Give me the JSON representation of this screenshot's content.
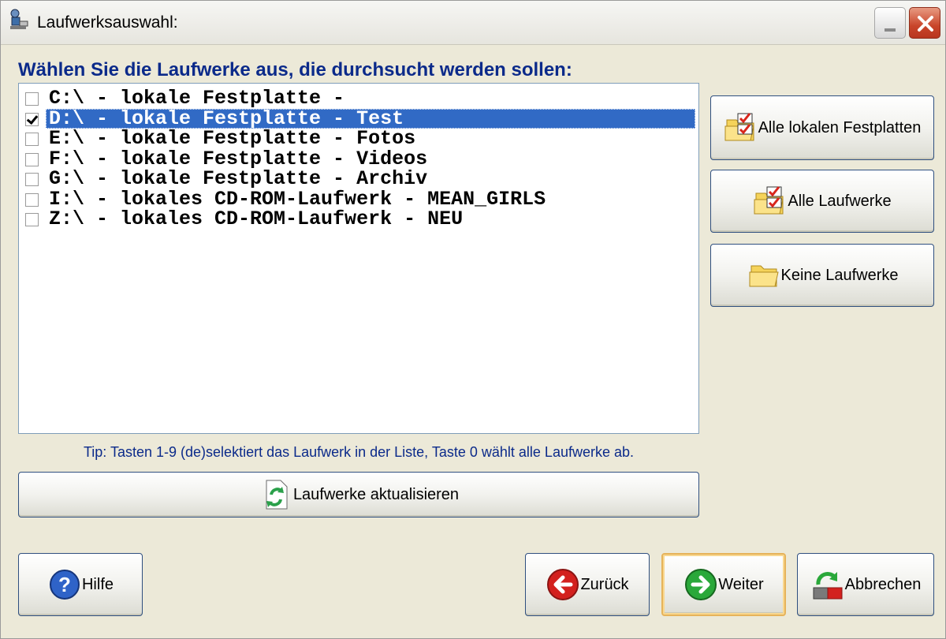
{
  "window": {
    "title": "Laufwerksauswahl:"
  },
  "heading": "Wählen Sie die Laufwerke aus, die durchsucht werden sollen:",
  "drives": [
    {
      "label": "C:\\ - lokale Festplatte -",
      "checked": false,
      "selected": false
    },
    {
      "label": "D:\\ - lokale Festplatte - Test",
      "checked": true,
      "selected": true
    },
    {
      "label": "E:\\ - lokale Festplatte - Fotos",
      "checked": false,
      "selected": false
    },
    {
      "label": "F:\\ - lokale Festplatte - Videos",
      "checked": false,
      "selected": false
    },
    {
      "label": "G:\\ - lokale Festplatte - Archiv",
      "checked": false,
      "selected": false
    },
    {
      "label": "I:\\ - lokales CD-ROM-Laufwerk - MEAN_GIRLS",
      "checked": false,
      "selected": false
    },
    {
      "label": "Z:\\ - lokales CD-ROM-Laufwerk - NEU",
      "checked": false,
      "selected": false
    }
  ],
  "side_buttons": {
    "all_local": "Alle lokalen Festplatten",
    "all_drives": "Alle Laufwerke",
    "no_drives": "Keine Laufwerke"
  },
  "tip": "Tip: Tasten 1-9 (de)selektiert das Laufwerk in der Liste, Taste 0 wählt alle Laufwerke ab.",
  "refresh_label": "Laufwerke aktualisieren",
  "footer": {
    "help": "Hilfe",
    "back": "Zurück",
    "next": "Weiter",
    "cancel": "Abbrechen"
  },
  "colors": {
    "heading": "#0b2a8a",
    "selection": "#316ac5"
  },
  "icons": {
    "title": "app-icon",
    "all_local": "folder-check-icon",
    "all_drives": "folder-check-icon",
    "no_drives": "folder-icon",
    "refresh": "refresh-icon",
    "help": "help-icon",
    "back": "back-arrow-icon",
    "next": "forward-arrow-icon",
    "cancel": "cancel-icon"
  }
}
